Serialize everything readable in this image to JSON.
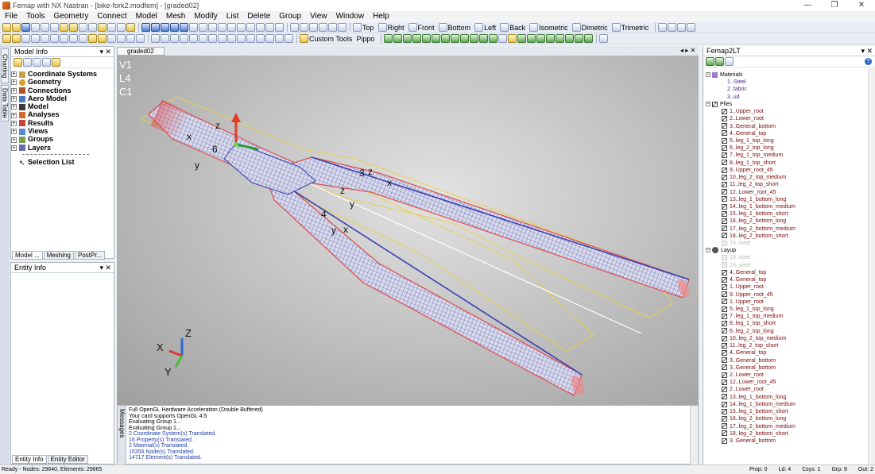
{
  "window": {
    "title": "Femap with NX Nastran - [bike-fork2.modfem] - [graded02]",
    "min": "—",
    "restore": "❐",
    "close": "✕"
  },
  "menu": [
    "File",
    "Tools",
    "Geometry",
    "Connect",
    "Model",
    "Mesh",
    "Modify",
    "List",
    "Delete",
    "Group",
    "View",
    "Window",
    "Help"
  ],
  "toolbar": {
    "views": [
      "Top",
      "Right",
      "Front",
      "Bottom",
      "Left",
      "Back",
      "Isometric",
      "Dimetric",
      "Trimetric"
    ],
    "custom_tools": "Custom Tools",
    "pippo": "Pippo"
  },
  "left_strip": {
    "charting": "Charting",
    "data_table": "Data Table"
  },
  "model_info": {
    "title": "Model Info",
    "tree": [
      {
        "label": "Coordinate Systems",
        "bold": true
      },
      {
        "label": "Geometry",
        "bold": true
      },
      {
        "label": "Connections",
        "bold": true
      },
      {
        "label": "Aero Model",
        "bold": true
      },
      {
        "label": "Model",
        "bold": true
      },
      {
        "label": "Analyses",
        "bold": true
      },
      {
        "label": "Results",
        "bold": true
      },
      {
        "label": "Views",
        "bold": true
      },
      {
        "label": "Groups",
        "bold": true
      },
      {
        "label": "Layers",
        "bold": true
      }
    ],
    "selection_list": "Selection List",
    "tabs": [
      "Model ...",
      "Meshing",
      "PostPr..."
    ]
  },
  "entity_info": {
    "title": "Entity Info",
    "tabs": [
      "Entity Info",
      "Entity Editor"
    ]
  },
  "viewport": {
    "tab": "graded02",
    "labels": [
      "V1",
      "L4",
      "C1"
    ],
    "annotations": [
      "z",
      "x",
      "6",
      "y",
      "3",
      "z",
      "x",
      "z",
      "y",
      "4",
      "y",
      "x"
    ],
    "triad": {
      "x": "X",
      "y": "Y",
      "z": "Z"
    }
  },
  "messages": {
    "title": "Messages",
    "lines": [
      {
        "text": "Full OpenGL Hardware Acceleration (Double Buffered)",
        "color": "#000000"
      },
      {
        "text": "Your card supports OpenGL 4.5",
        "color": "#000000"
      },
      {
        "text": "Evaluating Group 1...",
        "color": "#000000"
      },
      {
        "text": "Evaluating Group 1...",
        "color": "#000000"
      },
      {
        "text": "2 Coordinate System(s) Translated.",
        "color": "#1f3fa8"
      },
      {
        "text": "16 Property(s) Translated.",
        "color": "#1f3fa8"
      },
      {
        "text": "2 Material(s) Translated.",
        "color": "#1f3fa8"
      },
      {
        "text": "15356 Node(s) Translated.",
        "color": "#1f3fa8"
      },
      {
        "text": "14717 Element(s) Translated.",
        "color": "#1f3fa8"
      }
    ]
  },
  "femap2lt": {
    "title": "Femap2LT",
    "materials_label": "Materials",
    "materials": [
      "1..Steel",
      "2..fabric",
      "3..ud"
    ],
    "plies_label": "Plies",
    "plies": [
      {
        "label": "1..Upper_root",
        "dim": false
      },
      {
        "label": "2..Lower_root",
        "dim": false
      },
      {
        "label": "3..General_bottom",
        "dim": false
      },
      {
        "label": "4..General_top",
        "dim": false
      },
      {
        "label": "5..leg_1_top_long",
        "dim": false
      },
      {
        "label": "6..leg_2_top_long",
        "dim": false
      },
      {
        "label": "7..leg_1_top_medium",
        "dim": false
      },
      {
        "label": "8..leg_1_top_short",
        "dim": false
      },
      {
        "label": "9..Upper_root_45",
        "dim": false
      },
      {
        "label": "10..leg_2_top_medium",
        "dim": false
      },
      {
        "label": "11..leg_2_top_short",
        "dim": false
      },
      {
        "label": "12..Lower_root_45",
        "dim": false
      },
      {
        "label": "13..leg_1_bottom_long",
        "dim": false
      },
      {
        "label": "14..leg_1_bottom_medium",
        "dim": false
      },
      {
        "label": "15..leg_1_bottom_short",
        "dim": false
      },
      {
        "label": "16..leg_2_bottom_long",
        "dim": false
      },
      {
        "label": "17..leg_2_bottom_medium",
        "dim": false
      },
      {
        "label": "18..leg_2_bottom_short",
        "dim": false
      },
      {
        "label": "19..steel",
        "dim": true
      }
    ],
    "layup_label": "Layup",
    "layup": [
      {
        "label": "19..steel",
        "dim": true
      },
      {
        "label": "19..steel",
        "dim": true
      },
      {
        "label": "4..General_top",
        "dim": false
      },
      {
        "label": "4..General_top",
        "dim": false
      },
      {
        "label": "1..Upper_root",
        "dim": false
      },
      {
        "label": "9..Upper_root_45",
        "dim": false
      },
      {
        "label": "1..Upper_root",
        "dim": false
      },
      {
        "label": "5..leg_1_top_long",
        "dim": false
      },
      {
        "label": "7..leg_1_top_medium",
        "dim": false
      },
      {
        "label": "8..leg_1_top_short",
        "dim": false
      },
      {
        "label": "6..leg_2_top_long",
        "dim": false
      },
      {
        "label": "10..leg_2_top_medium",
        "dim": false
      },
      {
        "label": "11..leg_2_top_short",
        "dim": false
      },
      {
        "label": "4..General_top",
        "dim": false
      },
      {
        "label": "3..General_bottom",
        "dim": false
      },
      {
        "label": "3..General_bottom",
        "dim": false
      },
      {
        "label": "2..Lower_root",
        "dim": false
      },
      {
        "label": "12..Lower_root_45",
        "dim": false
      },
      {
        "label": "2..Lower_root",
        "dim": false
      },
      {
        "label": "13..leg_1_bottom_long",
        "dim": false
      },
      {
        "label": "14..leg_1_bottom_medium",
        "dim": false
      },
      {
        "label": "15..leg_1_bottom_short",
        "dim": false
      },
      {
        "label": "16..leg_2_bottom_long",
        "dim": false
      },
      {
        "label": "17..leg_2_bottom_medium",
        "dim": false
      },
      {
        "label": "18..leg_2_bottom_short",
        "dim": false
      },
      {
        "label": "3..General_bottom",
        "dim": false
      }
    ]
  },
  "status": {
    "left": "Ready - Nodes: 29640,  Elements: 29665",
    "prop": "Prop: 0",
    "ld": "Ld: 4",
    "csys": "Csys: 1",
    "grp": "Grp: 9",
    "out": "Out: 2"
  },
  "colors": {
    "mesh_blue": "#3a3fb0",
    "mesh_red": "#e04a4a",
    "ply_outline": "#e6d24a",
    "ply_label": "#7a0a0a"
  }
}
